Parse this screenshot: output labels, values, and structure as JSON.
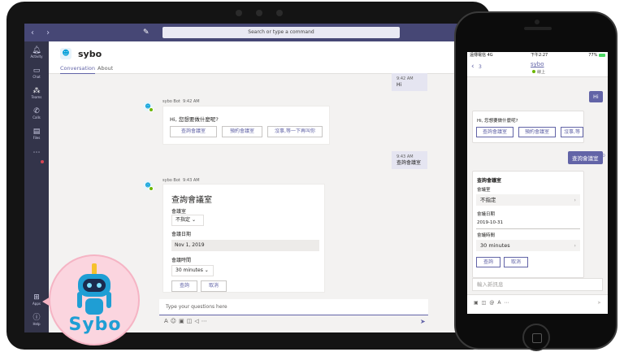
{
  "desktop": {
    "search_placeholder": "Search or type a command",
    "rail": [
      {
        "label": "Activity",
        "icon": "bell-icon"
      },
      {
        "label": "Chat",
        "icon": "chat-icon"
      },
      {
        "label": "Teams",
        "icon": "teams-icon"
      },
      {
        "label": "Calls",
        "icon": "phone-icon"
      },
      {
        "label": "Files",
        "icon": "file-icon"
      },
      {
        "label": "Apps",
        "icon": "apps-icon"
      },
      {
        "label": "Help",
        "icon": "help-icon"
      }
    ],
    "header": {
      "title": "sybo",
      "tabs": [
        "Conversation",
        "About"
      ]
    },
    "messages": [
      {
        "time": "9:42 AM",
        "text": "Hi"
      },
      {
        "time": "9:43 AM",
        "text": "查詢會議室"
      }
    ],
    "bot_card1": {
      "sender": "sybo Bot",
      "time": "9:42 AM",
      "question": "Hi, 您想要做什麼呢?",
      "buttons": [
        "查詢會議室",
        "預約會議室",
        "沒事,等一下再叫你"
      ]
    },
    "bot_card2": {
      "sender": "sybo Bot",
      "time": "9:43 AM",
      "title": "查詢會議室",
      "room_label": "會議室",
      "room_value": "不指定",
      "date_label": "會議日期",
      "date_value": "Nov 1, 2019",
      "duration_label": "會議時間",
      "duration_value": "30 minutes",
      "buttons": [
        "查詢",
        "取消"
      ]
    },
    "composer_placeholder": "Type your questions here"
  },
  "mascot": {
    "text": "Sybo"
  },
  "phone": {
    "status": {
      "carrier": "遠傳電信 4G",
      "time": "下午2:27",
      "battery": "77%"
    },
    "nav": {
      "back_count": "3",
      "title": "sybo",
      "subtitle": "線上"
    },
    "user_hi": "Hi",
    "card1": {
      "question": "Hi, 您想要做什麼呢?",
      "buttons": [
        "查詢會議室",
        "預約會議室",
        "沒事,等"
      ]
    },
    "user_query": "查詢會議室",
    "card2": {
      "title": "查詢會議室",
      "room_label": "會議室",
      "room_value": "不指定",
      "date_label": "會議日期",
      "date_value": "2019-10-31",
      "duration_label": "會議時間",
      "duration_value": "30 minutes",
      "buttons": [
        "查詢",
        "取消"
      ]
    },
    "input_placeholder": "輸入新訊息"
  },
  "colors": {
    "accent": "#6264a7",
    "rail": "#33344a",
    "topbar": "#464775",
    "bot": "#0aa2da"
  }
}
